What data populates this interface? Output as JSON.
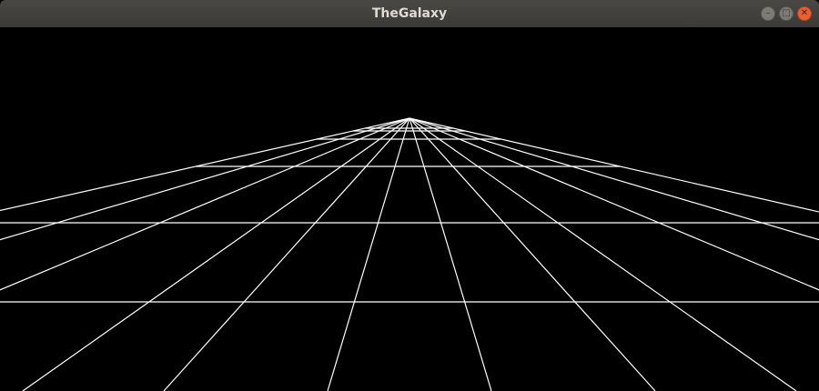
{
  "window": {
    "title": "TheGalaxy",
    "controls": {
      "minimize_icon": "minimize-icon",
      "maximize_icon": "maximize-icon",
      "close_icon": "close-icon"
    }
  },
  "scene": {
    "background": "#000000",
    "line_color": "#ffffff"
  }
}
